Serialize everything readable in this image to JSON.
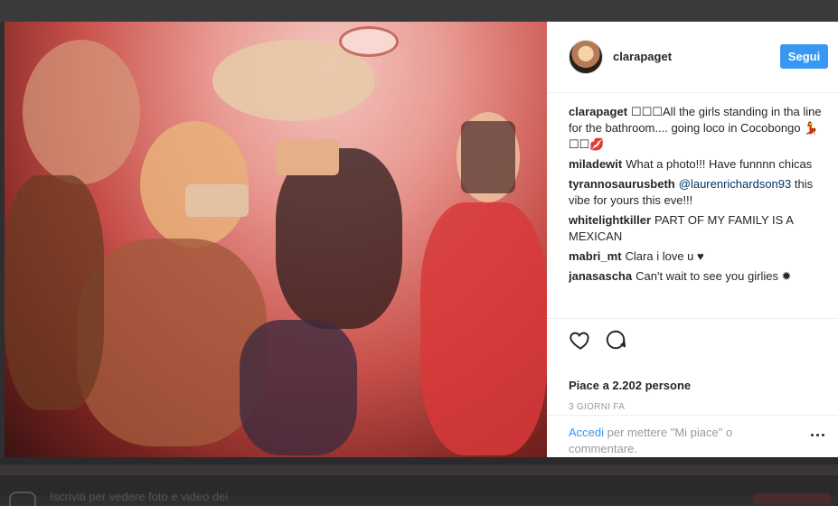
{
  "post": {
    "username": "clarapaget",
    "follow_label": "Segui",
    "avatar_icon": "profile-avatar"
  },
  "comments": [
    {
      "user": "clarapaget",
      "text": "☐☐☐All the girls standing in tha line for the bathroom.... going loco in Cocobongo 💃☐☐💋"
    },
    {
      "user": "miladewit",
      "text": "What a photo!!! Have funnnn chicas"
    },
    {
      "user": "tyrannosaurusbeth",
      "mention": "@laurenrichardson93",
      "text": "this vibe for yours this eve!!!"
    },
    {
      "user": "whitelightkiller",
      "text": "PART OF MY FAMILY IS A MEXICAN"
    },
    {
      "user": "mabri_mt",
      "text": "Clara i love u ♥"
    },
    {
      "user": "janasascha",
      "text": "Can't wait to see you girlies ✹"
    }
  ],
  "actions": {
    "like_icon": "heart-outline-icon",
    "comment_icon": "comment-bubble-icon",
    "likes_text": "Piace a 2.202 persone",
    "timestamp": "3 GIORNI FA"
  },
  "login": {
    "link_text": "Accedi",
    "rest_text": " per mettere \"Mi piace\" o commentare.",
    "more_icon": "more-dots-icon"
  },
  "footer": {
    "partial_text": "Iscriviti per vedere foto e video dei"
  },
  "colors": {
    "accent": "#3897f0",
    "text": "#262626",
    "muted": "#999999",
    "mention": "#003569"
  }
}
